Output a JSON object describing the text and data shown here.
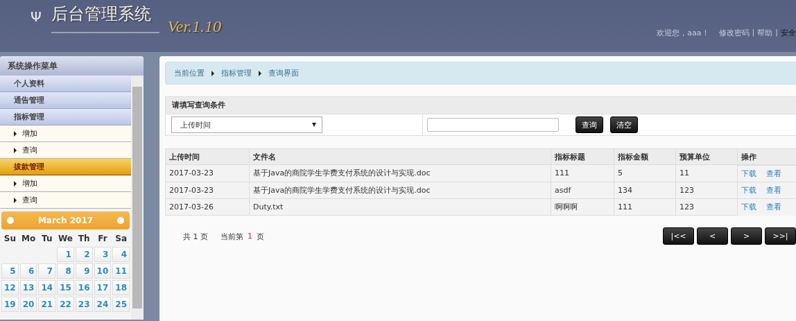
{
  "header": {
    "symbol": "Ψ",
    "title": "后台管理系统",
    "version": "Ver.1.10",
    "welcome": "欢迎您，aaa！",
    "links": [
      {
        "label": "修改密码"
      },
      {
        "label": "帮助"
      },
      {
        "label": "安全"
      }
    ],
    "separators": [
      "|",
      "|"
    ]
  },
  "sidebar": {
    "title": "系统操作菜单",
    "items": [
      {
        "label": "个人资料",
        "selected": false
      },
      {
        "label": "通告管理",
        "selected": false
      },
      {
        "label": "指标管理",
        "selected": false,
        "children": [
          {
            "label": "增加",
            "selected": false
          },
          {
            "label": "查询",
            "selected": false
          }
        ]
      },
      {
        "label": "拔款管理",
        "selected": true,
        "children": [
          {
            "label": "增加",
            "selected": false
          },
          {
            "label": "查询",
            "selected": false
          }
        ]
      }
    ]
  },
  "calendar": {
    "month": "March 2017",
    "weekdays": [
      "Su",
      "Mo",
      "Tu",
      "We",
      "Th",
      "Fr",
      "Sa"
    ],
    "weeks": [
      [
        {
          "kind": "blank"
        },
        {
          "kind": "blank"
        },
        {
          "kind": "blank"
        },
        {
          "kind": "day",
          "label": "1"
        },
        {
          "kind": "day",
          "label": "2"
        },
        {
          "kind": "day",
          "label": "3"
        },
        {
          "kind": "day",
          "label": "4"
        }
      ],
      [
        {
          "kind": "day",
          "label": "5"
        },
        {
          "kind": "day",
          "label": "6"
        },
        {
          "kind": "day",
          "label": "7"
        },
        {
          "kind": "day",
          "label": "8"
        },
        {
          "kind": "day",
          "label": "9"
        },
        {
          "kind": "day",
          "label": "10"
        },
        {
          "kind": "day",
          "label": "11"
        }
      ],
      [
        {
          "kind": "day",
          "label": "12"
        },
        {
          "kind": "day",
          "label": "13"
        },
        {
          "kind": "day",
          "label": "14"
        },
        {
          "kind": "day",
          "label": "15"
        },
        {
          "kind": "day",
          "label": "16"
        },
        {
          "kind": "day",
          "label": "17"
        },
        {
          "kind": "day",
          "label": "18"
        }
      ],
      [
        {
          "kind": "day",
          "label": "19"
        },
        {
          "kind": "day",
          "label": "20"
        },
        {
          "kind": "day",
          "label": "21"
        },
        {
          "kind": "day",
          "label": "22"
        },
        {
          "kind": "day",
          "label": "23"
        },
        {
          "kind": "day",
          "label": "24"
        },
        {
          "kind": "day",
          "label": "25"
        }
      ]
    ]
  },
  "breadcrumb": [
    "当前位置",
    "指标管理",
    "查询界面"
  ],
  "query": {
    "title": "请填写查询条件",
    "select": {
      "value": "上传时间"
    },
    "buttons": [
      "查询",
      "清空"
    ]
  },
  "table": {
    "columns": [
      "上传时间",
      "文件名",
      "指标标题",
      "指标金额",
      "预算单位",
      "操作"
    ],
    "rows": [
      {
        "cells": [
          "2017-03-23",
          "基于Java的商院学生学费支付系统的设计与实现.doc",
          "111",
          "5",
          "11"
        ],
        "actions": [
          "下载",
          "查看"
        ]
      },
      {
        "cells": [
          "2017-03-23",
          "基于Java的商院学生学费支付系统的设计与实现.doc",
          "asdf",
          "134",
          "123"
        ],
        "actions": [
          "下载",
          "查看"
        ]
      },
      {
        "cells": [
          "2017-03-26",
          "Duty.txt",
          "啊啊啊",
          "111",
          "123"
        ],
        "actions": [
          "下载",
          "查看"
        ]
      }
    ]
  },
  "pager": {
    "total": "共 1 页",
    "current_label": "当前第",
    "current": "1",
    "unit": "页",
    "buttons": [
      "|<<",
      "<",
      ">",
      ">>|"
    ]
  }
}
